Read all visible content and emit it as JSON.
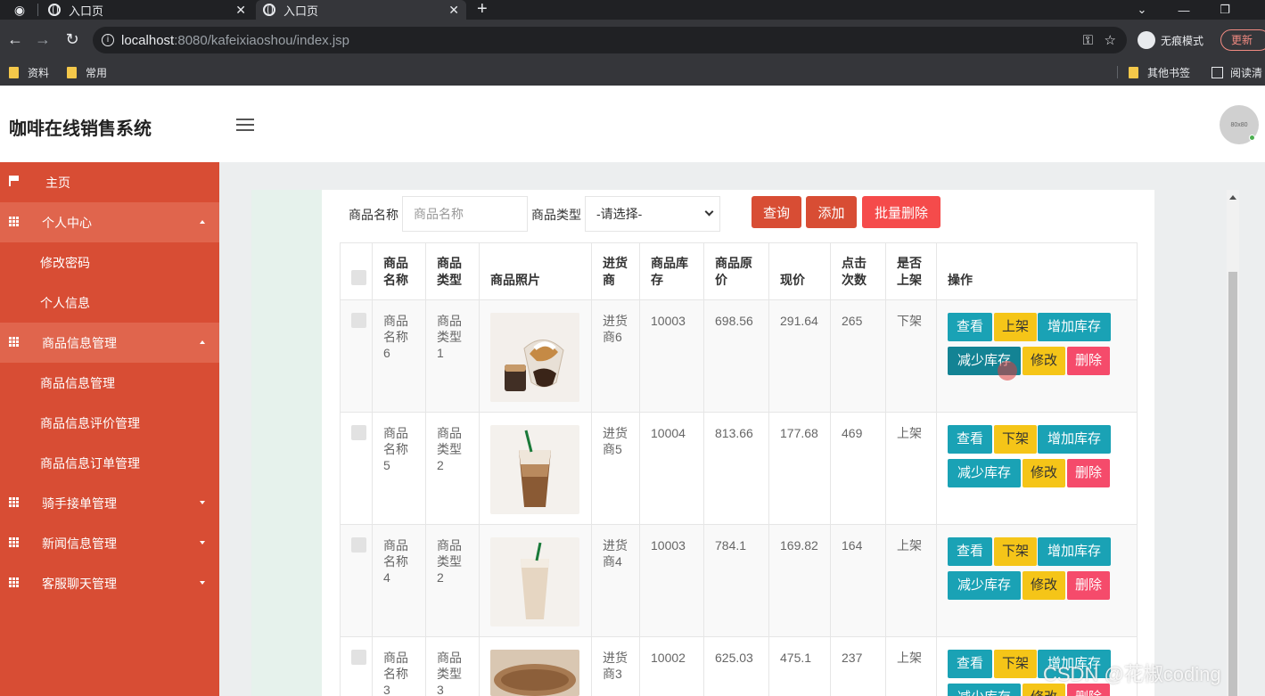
{
  "browser": {
    "tabs": [
      {
        "title": "入口页"
      },
      {
        "title": "入口页"
      }
    ],
    "address": {
      "host": "localhost",
      "path": ":8080/kafeixiaoshou/index.jsp"
    },
    "incognito_label": "无痕模式",
    "update_label": "更新",
    "bookmarks": [
      "资料",
      "常用"
    ],
    "bookmarks_right": [
      "其他书签",
      "阅读清"
    ]
  },
  "header": {
    "title": "咖啡在线销售系统",
    "avatar_text": "80x80"
  },
  "sidebar": {
    "items": [
      {
        "label": "主页",
        "type": "home"
      },
      {
        "label": "个人中心",
        "type": "group",
        "open": true
      },
      {
        "label": "修改密码",
        "type": "sub"
      },
      {
        "label": "个人信息",
        "type": "sub"
      },
      {
        "label": "商品信息管理",
        "type": "group",
        "open": true
      },
      {
        "label": "商品信息管理",
        "type": "sub"
      },
      {
        "label": "商品信息评价管理",
        "type": "sub"
      },
      {
        "label": "商品信息订单管理",
        "type": "sub"
      },
      {
        "label": "骑手接单管理",
        "type": "group",
        "open": false
      },
      {
        "label": "新闻信息管理",
        "type": "group",
        "open": false
      },
      {
        "label": "客服聊天管理",
        "type": "group",
        "open": false
      }
    ]
  },
  "search": {
    "name_label": "商品名称",
    "name_placeholder": "商品名称",
    "type_label": "商品类型",
    "type_selected": "-请选择-",
    "query_label": "查询",
    "add_label": "添加",
    "bulk_delete_label": "批量删除"
  },
  "table": {
    "headers": [
      "商品名称",
      "商品类型",
      "商品照片",
      "进货商",
      "商品库存",
      "商品原价",
      "现价",
      "点击次数",
      "是否上架",
      "操作"
    ],
    "rows": [
      {
        "name": "商品名称6",
        "type": "商品类型1",
        "supplier": "进货商6",
        "stock": "10003",
        "original_price": "698.56",
        "price": "291.64",
        "clicks": "265",
        "status": "下架",
        "toggle_label": "上架"
      },
      {
        "name": "商品名称5",
        "type": "商品类型2",
        "supplier": "进货商5",
        "stock": "10004",
        "original_price": "813.66",
        "price": "177.68",
        "clicks": "469",
        "status": "上架",
        "toggle_label": "下架"
      },
      {
        "name": "商品名称4",
        "type": "商品类型2",
        "supplier": "进货商4",
        "stock": "10003",
        "original_price": "784.1",
        "price": "169.82",
        "clicks": "164",
        "status": "上架",
        "toggle_label": "下架"
      },
      {
        "name": "商品名称3",
        "type": "商品类型3",
        "supplier": "进货商3",
        "stock": "10002",
        "original_price": "625.03",
        "price": "475.1",
        "clicks": "237",
        "status": "上架",
        "toggle_label": "下架"
      }
    ],
    "actions": {
      "view": "查看",
      "increase": "增加库存",
      "decrease": "减少库存",
      "edit": "修改",
      "delete": "删除"
    }
  },
  "watermark": "CSDN @花椒coding"
}
